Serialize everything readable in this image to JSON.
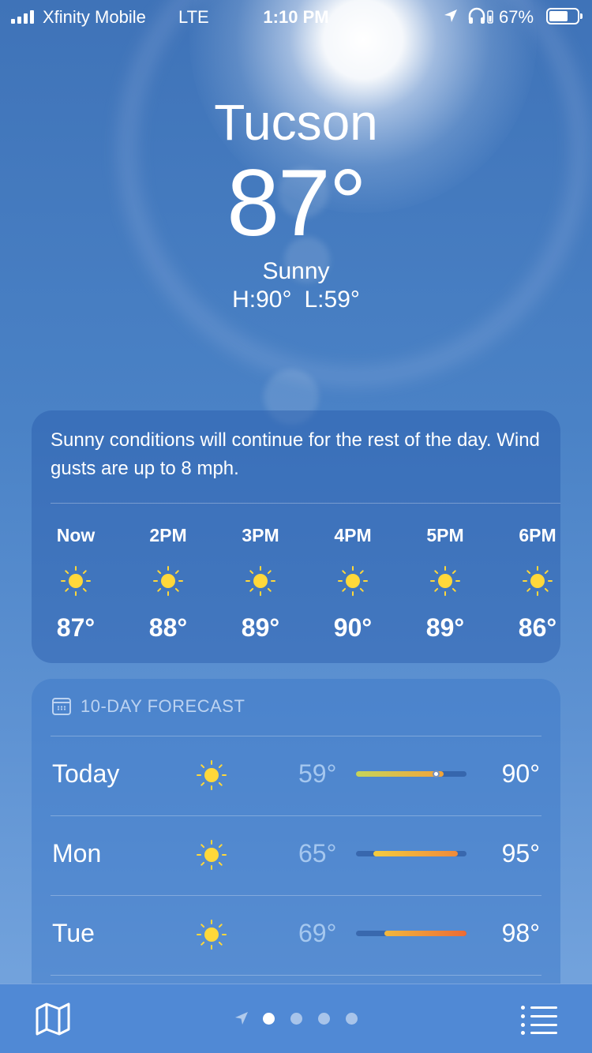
{
  "status_bar": {
    "carrier": "Xfinity Mobile",
    "network": "LTE",
    "time": "1:10 PM",
    "battery_percent": "67%",
    "battery_level": 0.67,
    "icons": [
      "signal-icon",
      "location-arrow-icon",
      "headphones-icon",
      "battery-icon"
    ]
  },
  "header": {
    "city": "Tucson",
    "temperature": "87°",
    "condition": "Sunny",
    "high": "H:90°",
    "low": "L:59°"
  },
  "hourly": {
    "summary": "Sunny conditions will continue for the rest of the day. Wind gusts are up to 8 mph.",
    "hours": [
      {
        "label": "Now",
        "icon": "sun-icon",
        "temp": "87°"
      },
      {
        "label": "2PM",
        "icon": "sun-icon",
        "temp": "88°"
      },
      {
        "label": "3PM",
        "icon": "sun-icon",
        "temp": "89°"
      },
      {
        "label": "4PM",
        "icon": "sun-icon",
        "temp": "90°"
      },
      {
        "label": "5PM",
        "icon": "sun-icon",
        "temp": "89°"
      },
      {
        "label": "6PM",
        "icon": "sun-icon",
        "temp": "86°"
      }
    ]
  },
  "forecast": {
    "title": "10-DAY FORECAST",
    "range_scale": {
      "min": 59,
      "max": 98
    },
    "days": [
      {
        "name": "Today",
        "icon": "sun-icon",
        "low": "59°",
        "high": "90°",
        "low_value": 59,
        "high_value": 90,
        "current_value": 87,
        "colors": [
          "#c6d45a",
          "#f2a33a"
        ]
      },
      {
        "name": "Mon",
        "icon": "sun-icon",
        "low": "65°",
        "high": "95°",
        "low_value": 65,
        "high_value": 95,
        "colors": [
          "#f4cc3e",
          "#f08a3a"
        ]
      },
      {
        "name": "Tue",
        "icon": "sun-icon",
        "low": "69°",
        "high": "98°",
        "low_value": 69,
        "high_value": 98,
        "colors": [
          "#f3b83d",
          "#ec6b35"
        ]
      }
    ]
  },
  "tab_bar": {
    "left_icon": "map-icon",
    "right_icon": "list-icon",
    "page_count": 4,
    "active_page": 0
  }
}
